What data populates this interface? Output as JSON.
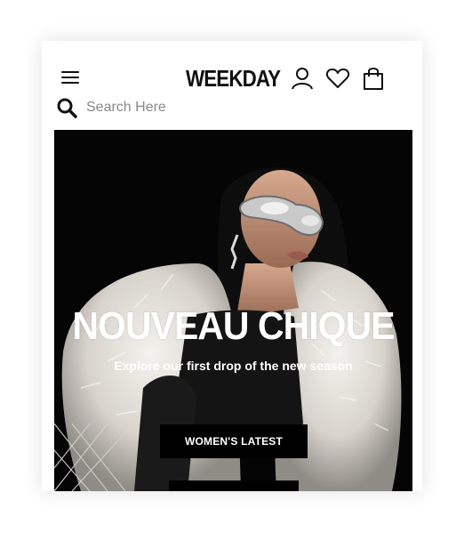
{
  "header": {
    "logo": "WEEKDAY",
    "menu_icon": "hamburger-menu-icon",
    "account_icon": "user-icon",
    "wishlist_icon": "heart-icon",
    "bag_icon": "shopping-bag-icon"
  },
  "search": {
    "icon": "search-icon",
    "placeholder": "Search Here"
  },
  "hero": {
    "title": "NOUVEAU CHIQUE",
    "subtitle": "Explore our first drop of the new season",
    "primary_button": "WOMEN'S LATEST",
    "background_color": "#050505"
  }
}
